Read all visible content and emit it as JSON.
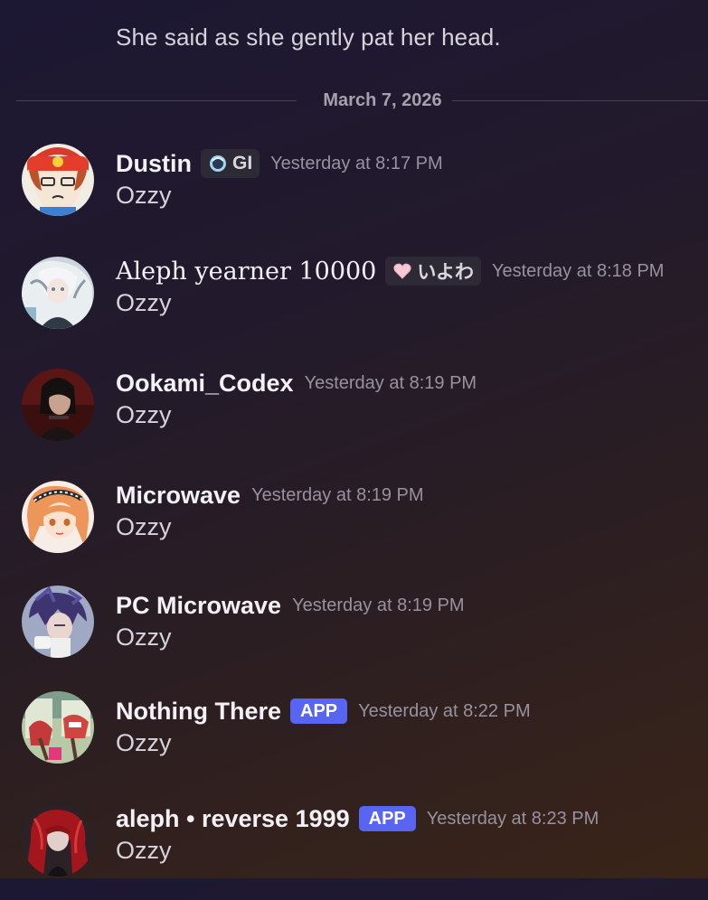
{
  "previous_message": {
    "text": "She said as she gently pat her head."
  },
  "date_divider": {
    "label": "March 7, 2026"
  },
  "messages": [
    {
      "username": "Dustin",
      "tag": {
        "icon": "blue-orb-icon",
        "text": "GI"
      },
      "timestamp": "Yesterday at 8:17 PM",
      "content": "Ozzy",
      "avatar_color": "#e8753a"
    },
    {
      "username": "Aleph yearner 10000",
      "tag": {
        "icon": "pink-heart-icon",
        "text": "いよわ"
      },
      "timestamp": "Yesterday at 8:18 PM",
      "content": "Ozzy",
      "avatar_color": "#a9b9c7"
    },
    {
      "username": "Ookami_Codex",
      "timestamp": "Yesterday at 8:19 PM",
      "content": "Ozzy",
      "avatar_color": "#6b1f1f"
    },
    {
      "username": "Microwave",
      "timestamp": "Yesterday at 8:19 PM",
      "content": "Ozzy",
      "avatar_color": "#f0a36a"
    },
    {
      "username": "PC Microwave",
      "timestamp": "Yesterday at 8:19 PM",
      "content": "Ozzy",
      "avatar_color": "#6a5f8f"
    },
    {
      "username": "Nothing There",
      "badge": "APP",
      "timestamp": "Yesterday at 8:22 PM",
      "content": "Ozzy",
      "avatar_color": "#8aa06a"
    },
    {
      "username": "aleph • reverse 1999",
      "badge": "APP",
      "timestamp": "Yesterday at 8:23 PM",
      "content": "Ozzy",
      "avatar_color": "#9b1d22"
    }
  ],
  "colors": {
    "app_badge": "#5865f2",
    "timestamp": "#97929f",
    "username": "#f3f1f5"
  }
}
